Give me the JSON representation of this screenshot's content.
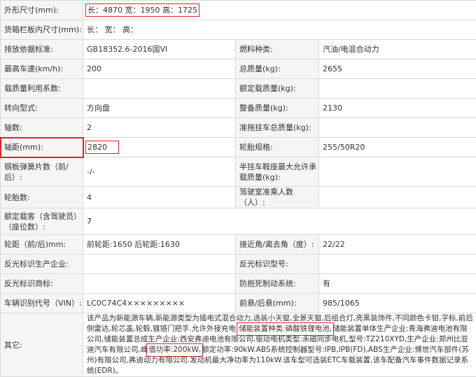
{
  "rows": [
    {
      "l1": "外形尺寸(mm):",
      "v1": "长：4870 宽：1950 高：1725"
    },
    {
      "l1": "货箱栏板内尺寸(mm):",
      "v1": "长：   宽：   高："
    },
    {
      "l1": "排放依据标准:",
      "v1": "GB18352.6-2016国VI",
      "l2": "燃料种类:",
      "v2": "汽油/电混合动力"
    },
    {
      "l1": "最高车速(km/h):",
      "v1": "200",
      "l2": "总质量(kg):",
      "v2": "2655"
    },
    {
      "l1": "载质量利用系数:",
      "v1": "",
      "l2": "额定载质量(kg):",
      "v2": ""
    },
    {
      "l1": "转向型式:",
      "v1": "方向盘",
      "l2": "整备质量(kg):",
      "v2": "2130"
    },
    {
      "l1": "轴数:",
      "v1": "2",
      "l2": "准拖挂车总质量(kg):",
      "v2": ""
    },
    {
      "l1": "轴距(mm):",
      "v1": "2820",
      "l2": "轮胎规格:",
      "v2": "255/50R20"
    },
    {
      "l1": "钢板弹簧片数（前/后）:",
      "v1": "-/-",
      "l2": "半挂车鞍座最大允许承载质量(kg):",
      "v2": ""
    },
    {
      "l1": "轮胎数:",
      "v1": "4",
      "l2": "驾驶室准乘人数（人）:",
      "v2": ""
    },
    {
      "l1": "额定载客（含驾驶员）（座位数）:",
      "v1": "7"
    },
    {
      "l1": "轮距（前/后)mm:",
      "v1": "前轮距:1650 后轮距:1630",
      "l2": "接近角/离去角（度）:",
      "v2": "22/22"
    },
    {
      "l1": "反光标识生产企业:",
      "v1": "",
      "l2": "反光标识型号:",
      "v2": ""
    },
    {
      "l1": "反光标识商标:",
      "v1": "",
      "l2": "防抱死制动系统:",
      "v2": "有"
    },
    {
      "l1": "车辆识别代号（VIN）:",
      "v1": "LC0C74C4×××××××××",
      "l2": "前悬/后悬(mm):",
      "v2": "985/1065"
    }
  ],
  "other": {
    "label": "其它:",
    "p1": "该产品为新能源车辆,新能源类型为插电式混合动力,选装小天窗,全景天窗,后组合灯,亮黑装饰件,不同颜色卡钳,字标,前后侧雷达,轮芯盖,轮毂,镀铬门把手.允许外接充电.",
    "p2": "储能装置种类:磷酸铁锂电池,",
    "p3": "储能装置单体生产企业:青海弗迪电池有限公司,储能装置总成生产企业:西安弗迪电池有限公司.驱动电机类型:永磁同步电机,型号:TZ210XYD,生产企业:郑州比亚迪汽车有限公司,峰",
    "p4": "值功率:200kW,",
    "p5": "额定功率:90kW.ABS系统控制器型号:IPB,IPB(FD),ABS生产企业:博世汽车部件(苏州)有限公司,弗迪动力有限公司.发动机最大净功率为110kW.该车型可选装ETC车载装置,该车配备汽车事件数据记录系统(EDR)。"
  }
}
